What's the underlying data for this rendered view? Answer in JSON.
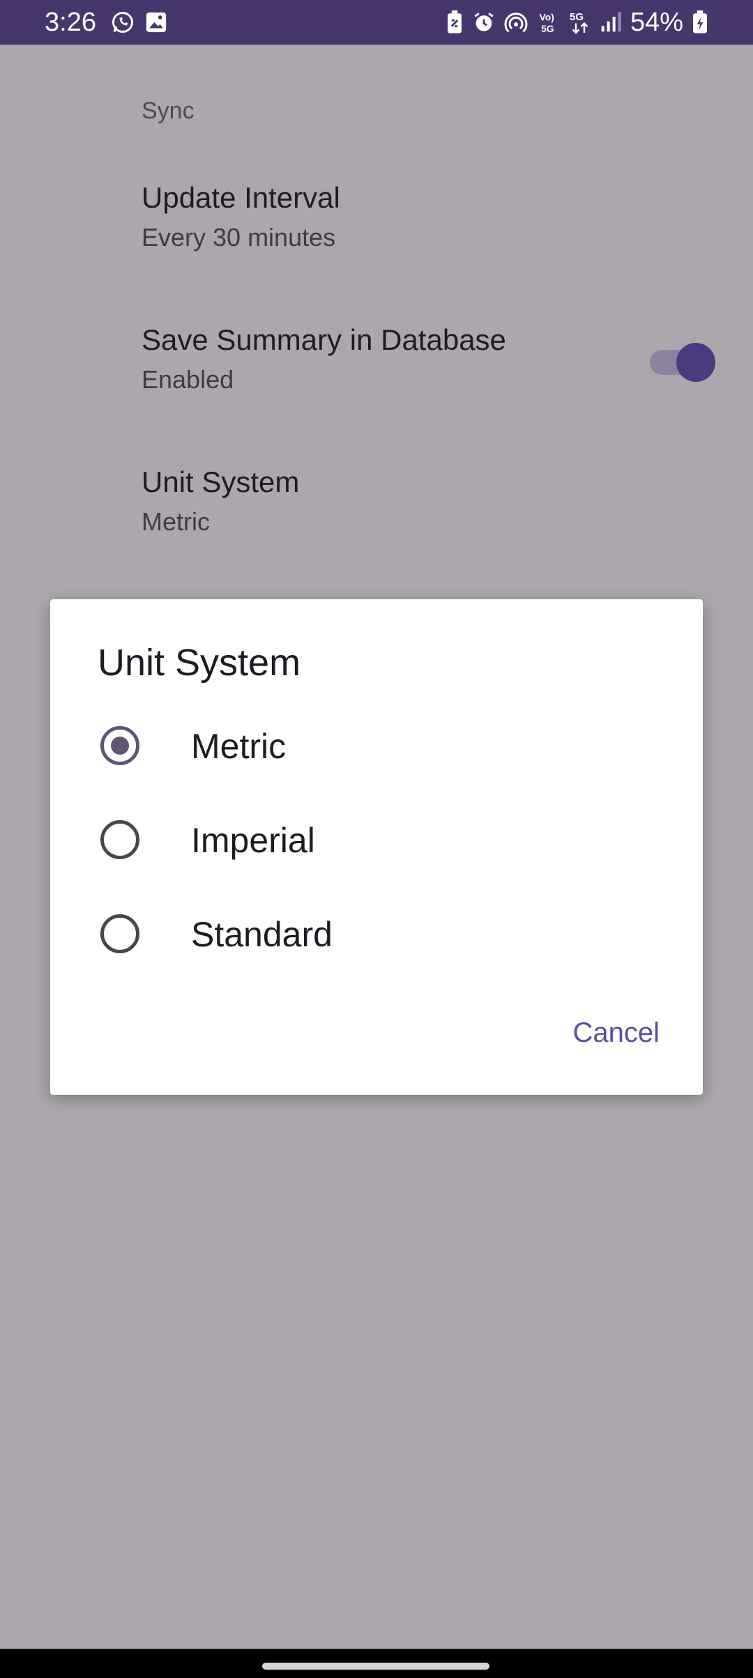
{
  "status_bar": {
    "time": "3:26",
    "battery_percent": "54%",
    "icons": [
      "whatsapp-icon",
      "gallery-icon",
      "battery-saver-icon",
      "alarm-icon",
      "hotspot-icon",
      "volte-icon",
      "5g-icon",
      "signal-icon",
      "battery-icon"
    ]
  },
  "settings": {
    "section_header": "Sync",
    "items": [
      {
        "title": "Update Interval",
        "summary": "Every 30 minutes"
      },
      {
        "title": "Save Summary in Database",
        "summary": "Enabled",
        "toggle_on": true
      },
      {
        "title": "Unit System",
        "summary": "Metric"
      }
    ]
  },
  "dialog": {
    "title": "Unit System",
    "options": [
      {
        "label": "Metric",
        "selected": true
      },
      {
        "label": "Imperial",
        "selected": false
      },
      {
        "label": "Standard",
        "selected": false
      }
    ],
    "cancel_label": "Cancel"
  },
  "colors": {
    "status_bar_bg": "#46366c",
    "scrim_bg": "#aca7ad",
    "accent": "#5e4d9a"
  }
}
